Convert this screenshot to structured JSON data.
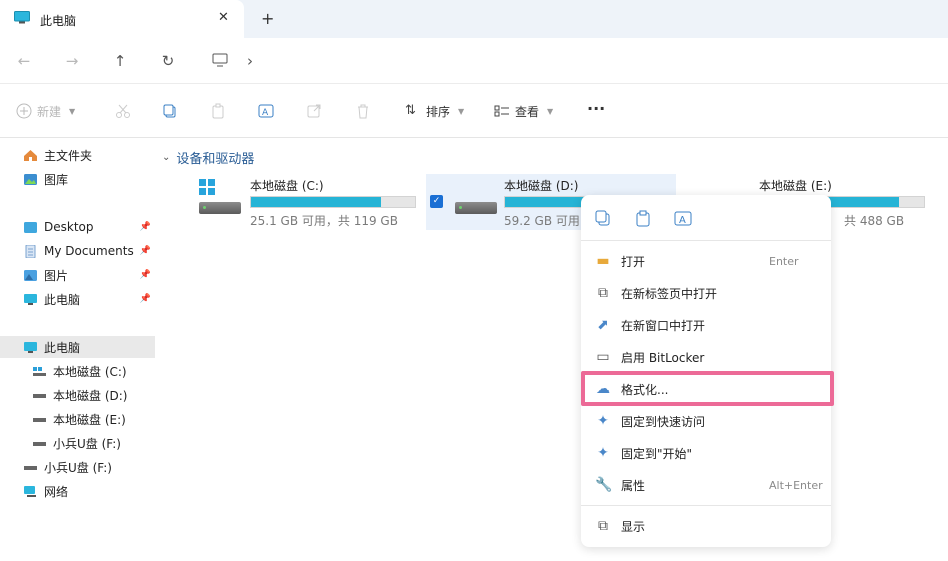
{
  "tab": {
    "title": "此电脑",
    "close": "✕",
    "add": "+"
  },
  "nav": {
    "back": "←",
    "forward": "→",
    "up": "↑",
    "refresh": "↻",
    "chevron": "›"
  },
  "toolbar": {
    "new_label": "新建",
    "sort_label": "排序",
    "view_label": "查看",
    "more": "···"
  },
  "sidebar": {
    "items": [
      {
        "label": "主文件夹"
      },
      {
        "label": "图库"
      },
      {
        "label": "Desktop"
      },
      {
        "label": "My Documents"
      },
      {
        "label": "图片"
      },
      {
        "label": "此电脑"
      },
      {
        "label": "此电脑"
      },
      {
        "label": "本地磁盘 (C:)"
      },
      {
        "label": "本地磁盘 (D:)"
      },
      {
        "label": "本地磁盘 (E:)"
      },
      {
        "label": "小兵U盘 (F:)"
      },
      {
        "label": "小兵U盘 (F:)"
      },
      {
        "label": "网络"
      }
    ]
  },
  "main": {
    "group_title": "设备和驱动器",
    "drives": [
      {
        "name": "本地磁盘 (C:)",
        "size": "25.1 GB 可用，共 119 GB",
        "used_fraction": 0.79
      },
      {
        "name": "本地磁盘 (D:)",
        "size": "59.2 GB 可用",
        "used_fraction": 0.5
      },
      {
        "name": "本地磁盘 (E:)",
        "size": "共 488 GB",
        "used_fraction": 0.85
      }
    ]
  },
  "context_menu": {
    "items": [
      {
        "label": "打开",
        "shortcut": "Enter",
        "icon": "folder-icon"
      },
      {
        "label": "在新标签页中打开",
        "shortcut": "",
        "icon": "new-tab-icon"
      },
      {
        "label": "在新窗口中打开",
        "shortcut": "",
        "icon": "new-window-icon"
      },
      {
        "label": "启用 BitLocker",
        "shortcut": "",
        "icon": "bitlocker-icon"
      },
      {
        "label": "格式化...",
        "shortcut": "",
        "icon": "format-icon"
      },
      {
        "label": "固定到快速访问",
        "shortcut": "",
        "icon": "pin-icon"
      },
      {
        "label": "固定到\"开始\"",
        "shortcut": "",
        "icon": "pin-icon"
      },
      {
        "label": "属性",
        "shortcut": "Alt+Enter",
        "icon": "wrench-icon"
      },
      {
        "label": "显示",
        "shortcut": "",
        "icon": "more-options-icon"
      }
    ]
  },
  "colors": {
    "accent": "#1a6fd4",
    "drive_fill": "#26b4d6",
    "highlight": "#ec6a97"
  }
}
